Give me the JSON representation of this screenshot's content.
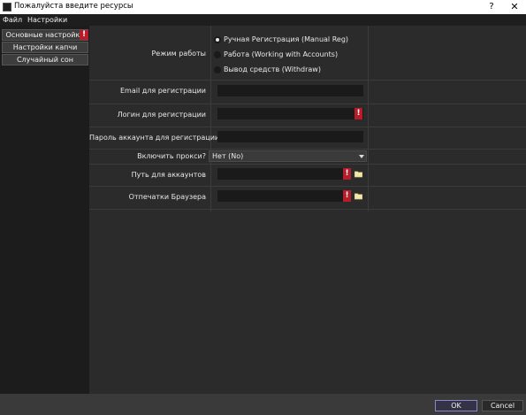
{
  "window": {
    "title": "Пожалуйста введите ресурсы",
    "help": "?",
    "close": "✕"
  },
  "menu": {
    "file": "Файл",
    "settings": "Настройки"
  },
  "nav": {
    "items": [
      {
        "label": "Основные настройки",
        "alert": "!"
      },
      {
        "label": "Настройки капчи"
      },
      {
        "label": "Случайный сон"
      }
    ]
  },
  "form": {
    "mode": {
      "label": "Режим работы",
      "options": [
        {
          "label": "Ручная Регистрация (Manual Reg)",
          "selected": true
        },
        {
          "label": "Работа (Working with Accounts)",
          "selected": false
        },
        {
          "label": "Вывод средств (Withdraw)",
          "selected": false
        }
      ]
    },
    "email": {
      "label": "Email для регистрации",
      "value": ""
    },
    "login": {
      "label": "Логин для регистрации",
      "value": "",
      "required": "!"
    },
    "password": {
      "label": "Пароль аккаунта для регистрации",
      "value": ""
    },
    "proxy": {
      "label": "Включить прокси?",
      "value": "Нет (No)"
    },
    "accounts_path": {
      "label": "Путь для аккаунтов",
      "value": "",
      "required": "!"
    },
    "browser_prints": {
      "label": "Отпечатки Браузера",
      "value": "",
      "required": "!"
    }
  },
  "footer": {
    "ok": "OK",
    "cancel": "Cancel"
  },
  "colors": {
    "alert": "#b81c2a",
    "ok_border": "#8a84c8",
    "background": "#2b2b2b",
    "field": "#1a1a1a"
  }
}
